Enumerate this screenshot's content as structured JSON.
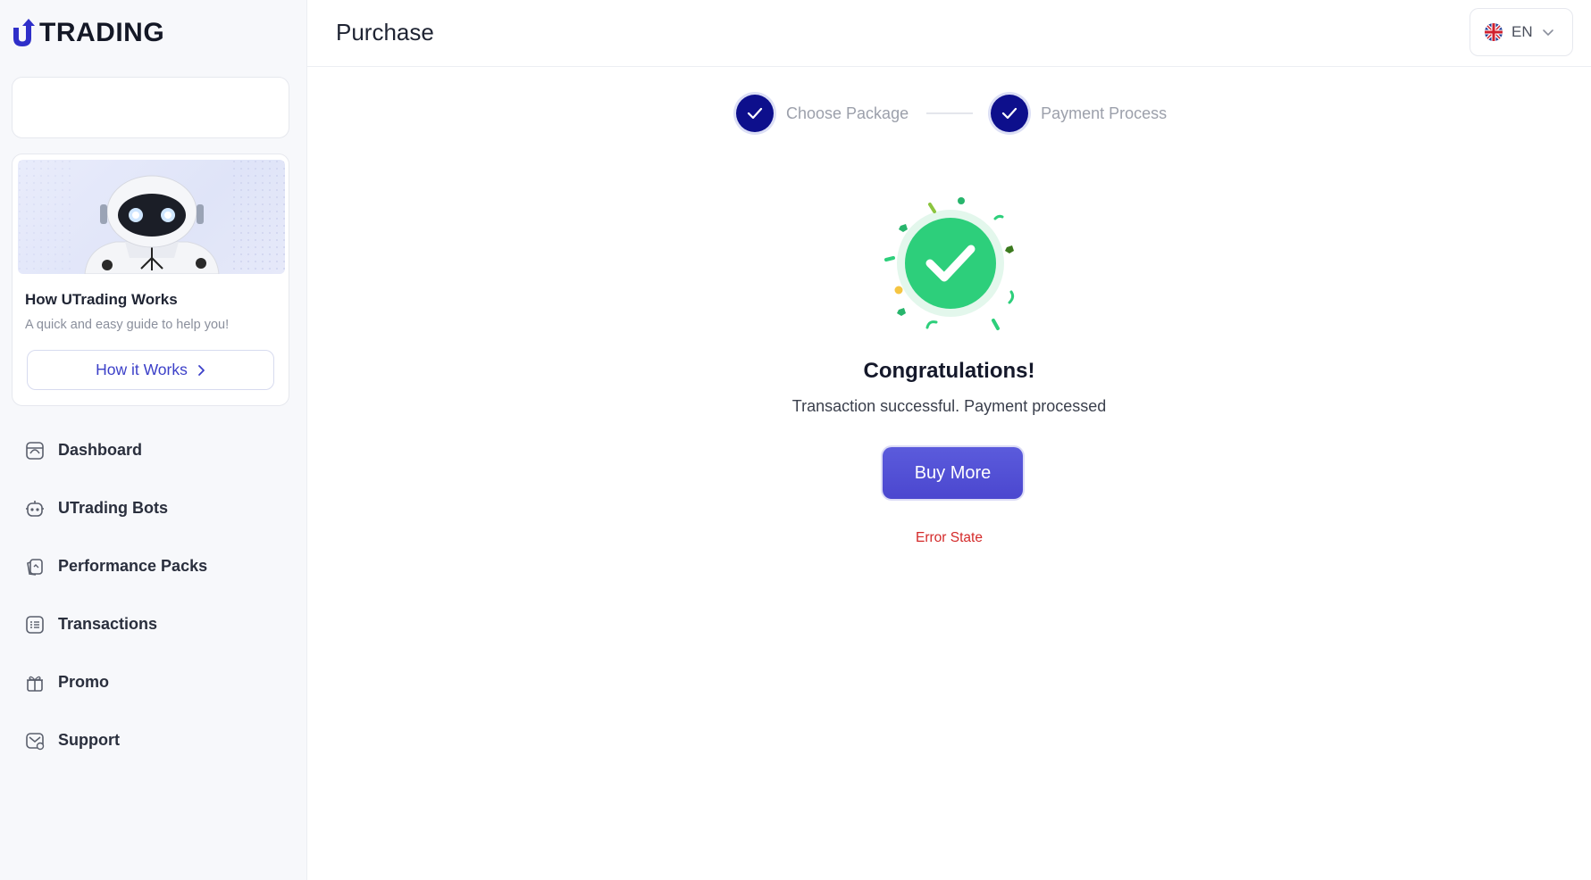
{
  "brand": {
    "logo_text": "TRADING",
    "logo_mark": "U"
  },
  "sidebar": {
    "guide": {
      "title": "How UTrading Works",
      "subtitle": "A quick and easy guide to help you!",
      "button_label": "How it Works"
    },
    "items": [
      {
        "label": "Dashboard",
        "icon": "dashboard-icon"
      },
      {
        "label": "UTrading Bots",
        "icon": "bot-icon"
      },
      {
        "label": "Performance Packs",
        "icon": "packs-icon"
      },
      {
        "label": "Transactions",
        "icon": "transactions-icon"
      },
      {
        "label": "Promo",
        "icon": "gift-icon"
      },
      {
        "label": "Support",
        "icon": "support-icon"
      }
    ]
  },
  "header": {
    "title": "Purchase",
    "language": "EN"
  },
  "stepper": {
    "steps": [
      {
        "label": "Choose Package",
        "completed": true
      },
      {
        "label": "Payment Process",
        "completed": true
      }
    ]
  },
  "result": {
    "title": "Congratulations!",
    "message": "Transaction successful. Payment processed",
    "button_label": "Buy More",
    "error_text": "Error State"
  },
  "colors": {
    "brand": "#2f2fc9",
    "step_done": "#0d0f8c",
    "success": "#2dcf7b",
    "button": "#4b47cf",
    "error": "#d42a2a"
  }
}
